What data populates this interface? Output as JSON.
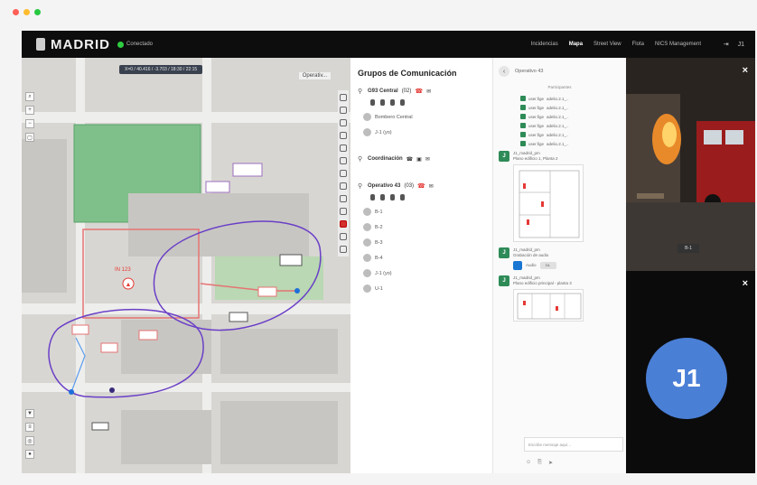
{
  "header": {
    "logo": "MADRID",
    "status": "Conectado",
    "nav": [
      "Incidencias",
      "Mapa",
      "Street View",
      "Flota",
      "NICS Management"
    ],
    "active_nav": "Mapa",
    "user": "J1"
  },
  "map": {
    "coords": "X=0 / 40.416 / -3.703 / 18:30 / 22:15",
    "layer": "Operativ...",
    "incident_label": "IN 123"
  },
  "comm": {
    "title": "Grupos de Comunicación",
    "groups": [
      {
        "name": "G93 Central",
        "count": "(02)",
        "members": [
          {
            "name": "Bombero Central",
            "extra": ""
          },
          {
            "name": "J-1 (yo)",
            "extra": ""
          }
        ]
      },
      {
        "name": "Coordinación",
        "count": "",
        "members": []
      },
      {
        "name": "Operativo 43",
        "count": "(03)",
        "members": [
          {
            "name": "B-1"
          },
          {
            "name": "B-2"
          },
          {
            "name": "B-3"
          },
          {
            "name": "B-4"
          },
          {
            "name": "J-1 (yo)"
          },
          {
            "name": "U-1"
          }
        ]
      }
    ]
  },
  "chat": {
    "title": "Operativo 43",
    "subheader": "Participantes",
    "checklist": [
      {
        "user": "user.fige",
        "file": "adelio.2.1_.."
      },
      {
        "user": "user.fige",
        "file": "adelio.2.1_.."
      },
      {
        "user": "user.fige",
        "file": "adelio.2.1_.."
      },
      {
        "user": "user.fige",
        "file": "adelio.2.1_.."
      },
      {
        "user": "user.fige",
        "file": "adelio.2.1_.."
      },
      {
        "user": "user.fige",
        "file": "adelio.2.1_.."
      }
    ],
    "messages": [
      {
        "author": "J1_madrid_pm",
        "text": "Plano edificio 1, Planta 2",
        "kind": "plan"
      },
      {
        "author": "J1_madrid_pm",
        "text": "Grabación de audio",
        "kind": "audio",
        "audio_label": "Audio",
        "download": "DL"
      },
      {
        "author": "J1_madrid_pm",
        "text": "Plano edificio principal - planta 3",
        "kind": "plan"
      }
    ],
    "input_placeholder": "Escribe mensaje aquí..."
  },
  "video": {
    "caption": "B-1",
    "avatar": "J1"
  },
  "colors": {
    "bg": "#111111",
    "accent_green": "#2e8b57",
    "avatar_blue": "#4a7fd6",
    "map_bg": "#d8d6d2",
    "route_purple": "#6a3fc7",
    "incident_red": "#e53935"
  },
  "icons": {
    "close": "close-icon",
    "back": "chevron-left-icon",
    "phone": "phone-icon",
    "chat": "chat-icon",
    "mic": "microphone-icon",
    "video": "camera-icon"
  }
}
